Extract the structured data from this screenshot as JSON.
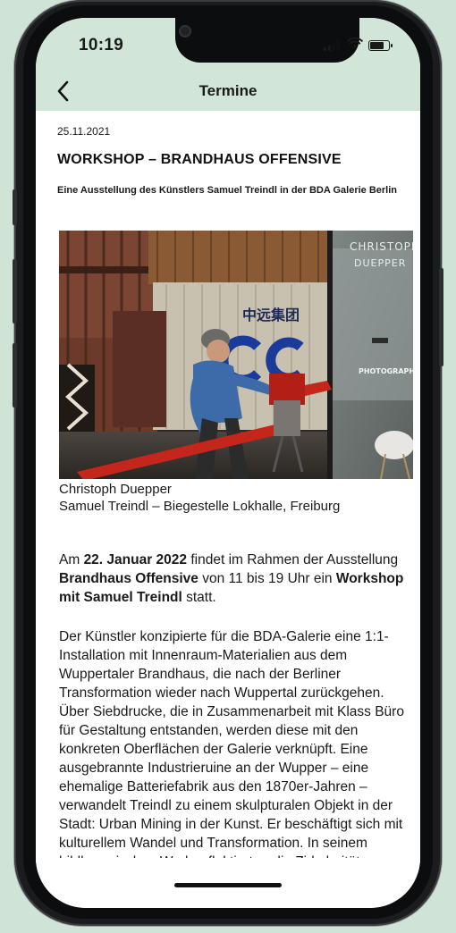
{
  "status_bar": {
    "time": "10:19"
  },
  "nav": {
    "title": "Termine",
    "back_icon": "chevron-left-icon"
  },
  "event": {
    "date": "25.11.2021",
    "title": "WORKSHOP – BRANDHAUS OFFENSIVE",
    "subtitle": "Eine Ausstellung des Künstlers Samuel Treindl in der BDA Galerie Berlin"
  },
  "photo": {
    "sign_top": "CHRISTOPH",
    "sign_bottom": "DUEPPER",
    "sign_photography": "PHOTOGRAPHY",
    "container_text": "中远集团"
  },
  "caption": {
    "line1": "Christoph Duepper",
    "line2": "Samuel Treindl – Biegestelle Lokhalle, Freiburg"
  },
  "paragraph1": {
    "t1": "Am ",
    "b1": "22. Januar 2022",
    "t2": " findet im Rahmen der Ausstellung ",
    "b2": "Brandhaus Offensive",
    "t3": " von 11 bis 19 Uhr ein ",
    "b3": "Workshop mit Samuel Treindl",
    "t4": " statt."
  },
  "paragraph2": "Der Künstler konzipierte für die BDA-Galerie eine 1:1-Installation mit Innenraum-Materialien aus dem Wuppertaler Brandhaus, die nach der Berliner Transformation wieder nach Wuppertal zurückgehen. Über Siebdrucke, die in Zusammenarbeit mit Klass Büro für Gestaltung entstanden, werden diese mit den konkreten Oberflächen der Galerie verknüpft. Eine ausgebrannte Industrieruine an der Wupper – eine ehemalige Batteriefabrik aus den 1870er-Jahren – verwandelt Treindl zu einem skulpturalen Objekt in der Stadt: Urban Mining in der Kunst. Er beschäftigt sich mit kulturellem Wandel und Transformation. In seinem bildhauerischen Werk reflektiert er die Zirkularität von Materialien, Raum und",
  "colors": {
    "header_bg": "#d1e6d8",
    "page_bg": "#cfe3d6"
  }
}
